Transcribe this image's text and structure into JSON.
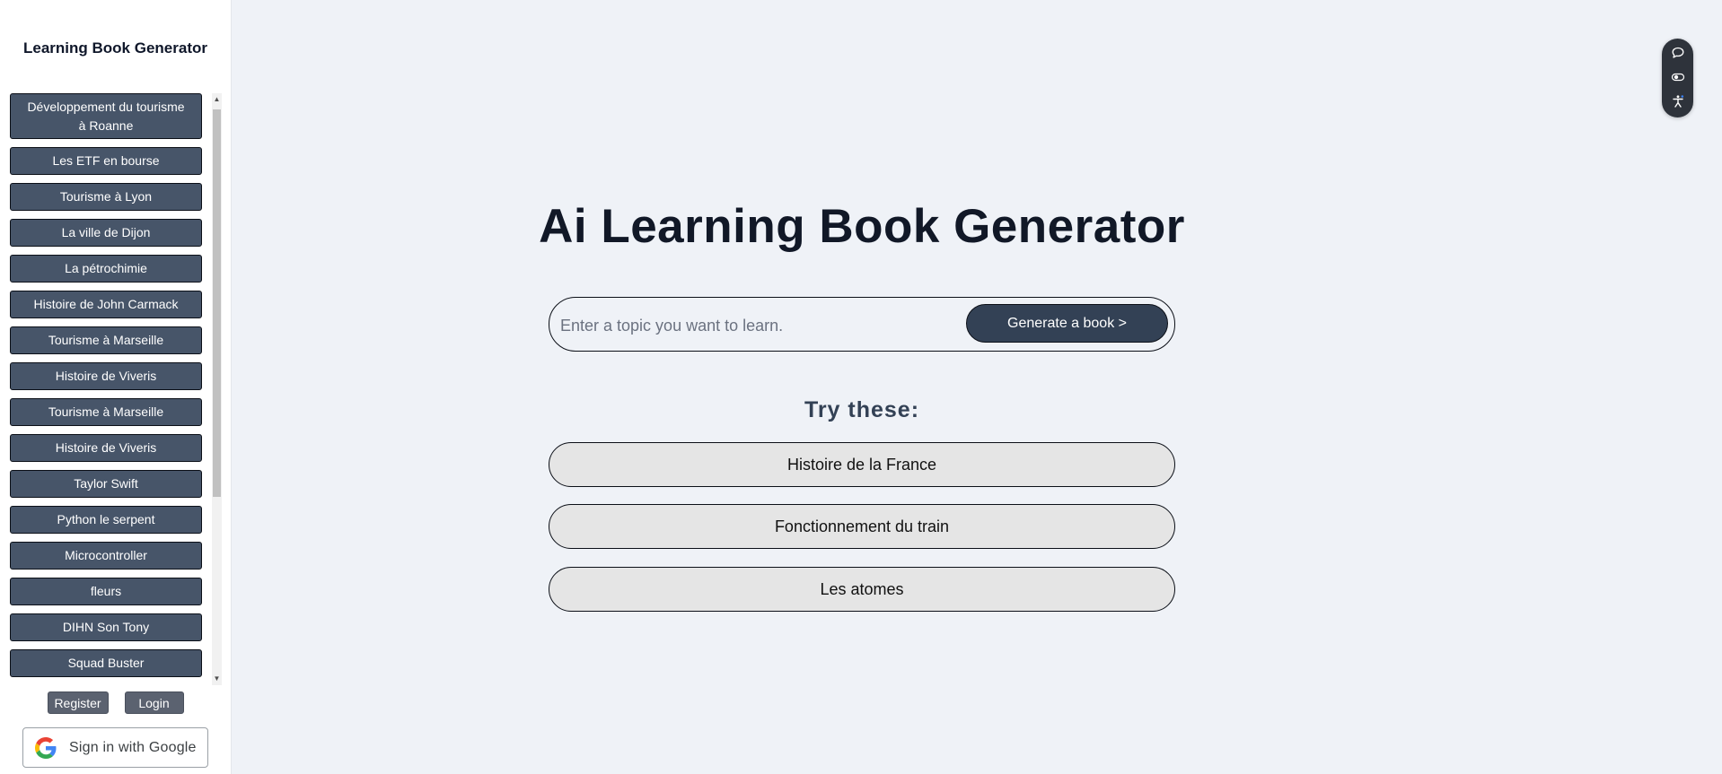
{
  "sidebar": {
    "title": "Learning Book Generator",
    "history": [
      "Développement du tourisme à Roanne",
      "Les ETF en bourse",
      "Tourisme à Lyon",
      "La ville de Dijon",
      "La pétrochimie",
      "Histoire de John Carmack",
      "Tourisme à Marseille",
      "Histoire de Viveris",
      "Tourisme à Marseille",
      "Histoire de Viveris",
      "Taylor Swift",
      "Python le serpent",
      "Microcontroller",
      "fleurs",
      "DIHN Son Tony",
      "Squad Buster"
    ],
    "register_label": "Register",
    "login_label": "Login",
    "google_label": "Sign in with Google"
  },
  "main": {
    "title": "Ai Learning Book Generator",
    "search_placeholder": "Enter a topic you want to learn.",
    "generate_label": "Generate a book >",
    "try_title": "Try these:",
    "suggestions": [
      "Histoire de la France",
      "Fonctionnement du train",
      "Les atomes"
    ]
  },
  "floating_toolbar": {
    "icons": [
      "chat-icon",
      "toggle-icon",
      "accessibility-icon"
    ]
  },
  "colors": {
    "background": "#eff2f7",
    "sidebar_button": "#475569",
    "generate_button": "#334155",
    "suggestion_bg": "#e5e5e5",
    "title_text": "#111827"
  }
}
